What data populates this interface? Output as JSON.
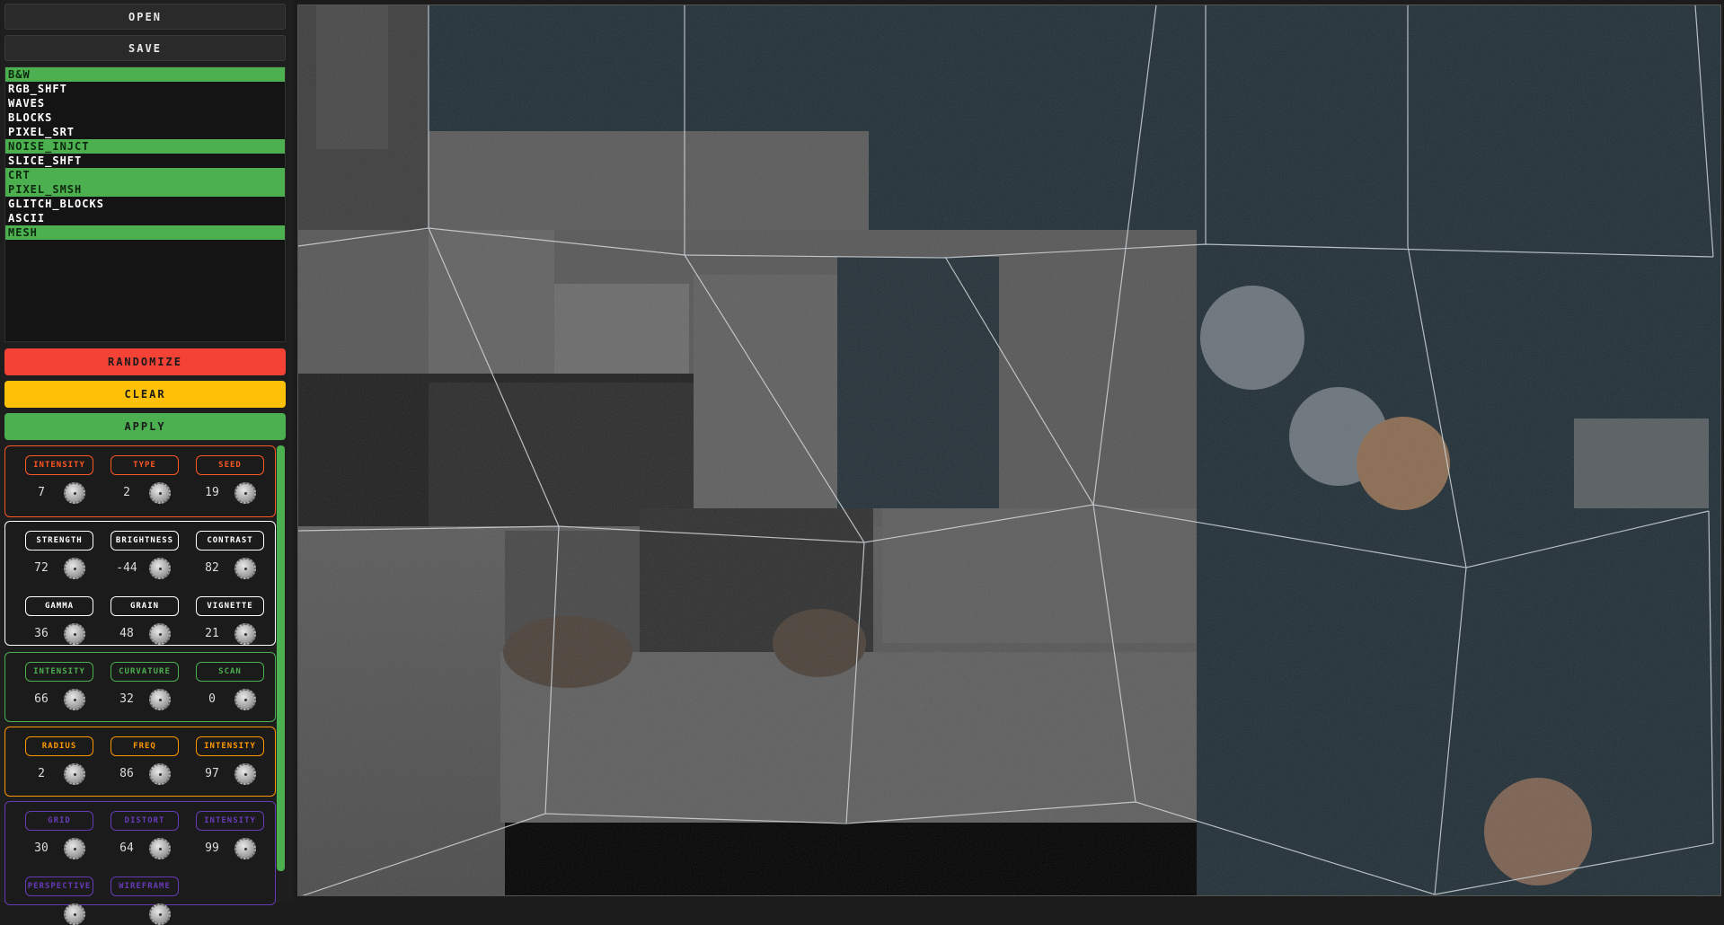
{
  "toolbar": {
    "open_label": "OPEN",
    "save_label": "SAVE"
  },
  "effects": [
    {
      "label": "B&W",
      "active": true
    },
    {
      "label": "RGB_SHFT",
      "active": false
    },
    {
      "label": "WAVES",
      "active": false
    },
    {
      "label": "BLOCKS",
      "active": false
    },
    {
      "label": "PIXEL_SRT",
      "active": false
    },
    {
      "label": "NOISE_INJCT",
      "active": true
    },
    {
      "label": "SLICE_SHFT",
      "active": false
    },
    {
      "label": "CRT",
      "active": true
    },
    {
      "label": "PIXEL_SMSH",
      "active": true
    },
    {
      "label": "GLITCH_BLOCKS",
      "active": false
    },
    {
      "label": "ASCII",
      "active": false
    },
    {
      "label": "MESH",
      "active": true
    }
  ],
  "actions": {
    "randomize_label": "RANDOMIZE",
    "clear_label": "CLEAR",
    "apply_label": "APPLY"
  },
  "colors": {
    "randomize": "#f44336",
    "clear": "#ffc107",
    "apply": "#4caf50",
    "active_effect": "#4caf50"
  },
  "panels": [
    {
      "color": "#ff5722",
      "params": [
        {
          "label": "INTENSITY",
          "value": "7"
        },
        {
          "label": "TYPE",
          "value": "2"
        },
        {
          "label": "SEED",
          "value": "19"
        }
      ]
    },
    {
      "color": "#ffffff",
      "params": [
        {
          "label": "STRENGTH",
          "value": "72"
        },
        {
          "label": "BRIGHTNESS",
          "value": "-44"
        },
        {
          "label": "CONTRAST",
          "value": "82"
        },
        {
          "label": "GAMMA",
          "value": "36"
        },
        {
          "label": "GRAIN",
          "value": "48"
        },
        {
          "label": "VIGNETTE",
          "value": "21"
        }
      ]
    },
    {
      "color": "#4caf50",
      "params": [
        {
          "label": "INTENSITY",
          "value": "66"
        },
        {
          "label": "CURVATURE",
          "value": "32"
        },
        {
          "label": "SCAN",
          "value": "0"
        }
      ]
    },
    {
      "color": "#ff9800",
      "params": [
        {
          "label": "RADIUS",
          "value": "2"
        },
        {
          "label": "FREQ",
          "value": "86"
        },
        {
          "label": "INTENSITY",
          "value": "97"
        }
      ]
    },
    {
      "color": "#673ab7",
      "params": [
        {
          "label": "GRID",
          "value": "30"
        },
        {
          "label": "DISTORT",
          "value": "64"
        },
        {
          "label": "INTENSITY",
          "value": "99"
        },
        {
          "label": "PERSPECTIVE",
          "value": ""
        },
        {
          "label": "WIREFRAME",
          "value": ""
        }
      ]
    }
  ]
}
